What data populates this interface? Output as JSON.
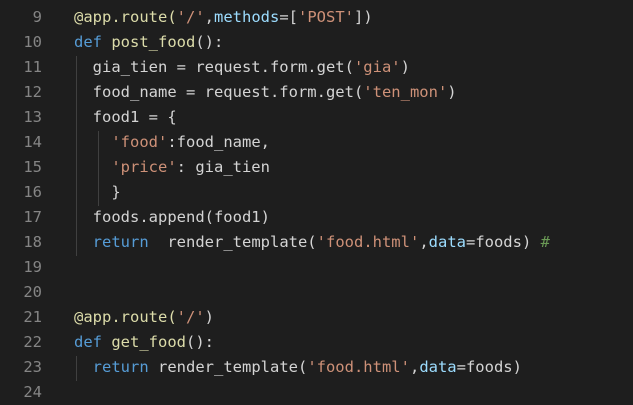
{
  "editor": {
    "lines": [
      {
        "num": "9",
        "segments": [
          {
            "t": "@app.route(",
            "c": "fn"
          },
          {
            "t": "'/'",
            "c": "str"
          },
          {
            "t": ",",
            "c": "txt"
          },
          {
            "t": "methods",
            "c": "var"
          },
          {
            "t": "=[",
            "c": "txt"
          },
          {
            "t": "'POST'",
            "c": "str"
          },
          {
            "t": "])",
            "c": "txt"
          }
        ]
      },
      {
        "num": "10",
        "segments": [
          {
            "t": "def ",
            "c": "kw"
          },
          {
            "t": "post_food",
            "c": "fn"
          },
          {
            "t": "():",
            "c": "txt"
          }
        ]
      },
      {
        "num": "11",
        "segments": [
          {
            "t": "  gia_tien = request.form.get(",
            "c": "txt"
          },
          {
            "t": "'gia'",
            "c": "str"
          },
          {
            "t": ")",
            "c": "txt"
          }
        ]
      },
      {
        "num": "12",
        "segments": [
          {
            "t": "  food_name = request.form.get(",
            "c": "txt"
          },
          {
            "t": "'ten_mon'",
            "c": "str"
          },
          {
            "t": ")",
            "c": "txt"
          }
        ]
      },
      {
        "num": "13",
        "segments": [
          {
            "t": "  food1 = {",
            "c": "txt"
          }
        ]
      },
      {
        "num": "14",
        "segments": [
          {
            "t": "    ",
            "c": "txt"
          },
          {
            "t": "'food'",
            "c": "str"
          },
          {
            "t": ":food_name,",
            "c": "txt"
          }
        ]
      },
      {
        "num": "15",
        "segments": [
          {
            "t": "    ",
            "c": "txt"
          },
          {
            "t": "'price'",
            "c": "str"
          },
          {
            "t": ": gia_tien",
            "c": "txt"
          }
        ]
      },
      {
        "num": "16",
        "segments": [
          {
            "t": "    }",
            "c": "txt"
          }
        ]
      },
      {
        "num": "17",
        "segments": [
          {
            "t": "  foods.append(food1)",
            "c": "txt"
          }
        ]
      },
      {
        "num": "18",
        "segments": [
          {
            "t": "  ",
            "c": "txt"
          },
          {
            "t": "return",
            "c": "kw"
          },
          {
            "t": "  render_template(",
            "c": "txt"
          },
          {
            "t": "'food.html'",
            "c": "str"
          },
          {
            "t": ",",
            "c": "txt"
          },
          {
            "t": "data",
            "c": "var"
          },
          {
            "t": "=foods) ",
            "c": "txt"
          },
          {
            "t": "#",
            "c": "cmt"
          }
        ]
      },
      {
        "num": "19",
        "segments": []
      },
      {
        "num": "20",
        "segments": []
      },
      {
        "num": "21",
        "segments": [
          {
            "t": "@app.route(",
            "c": "fn"
          },
          {
            "t": "'/'",
            "c": "str"
          },
          {
            "t": ")",
            "c": "txt"
          }
        ]
      },
      {
        "num": "22",
        "segments": [
          {
            "t": "def ",
            "c": "kw"
          },
          {
            "t": "get_food",
            "c": "fn"
          },
          {
            "t": "():",
            "c": "txt"
          }
        ]
      },
      {
        "num": "23",
        "segments": [
          {
            "t": "  ",
            "c": "txt"
          },
          {
            "t": "return",
            "c": "kw"
          },
          {
            "t": " render_template(",
            "c": "txt"
          },
          {
            "t": "'food.html'",
            "c": "str"
          },
          {
            "t": ",",
            "c": "txt"
          },
          {
            "t": "data",
            "c": "var"
          },
          {
            "t": "=foods)",
            "c": "txt"
          }
        ]
      },
      {
        "num": "24",
        "segments": []
      }
    ]
  },
  "colors": {
    "background": "#1e1e1e",
    "line_number": "#858585",
    "keyword": "#569cd6",
    "string": "#ce9178",
    "function": "#dcdcaa",
    "parameter": "#9cdcfe",
    "comment": "#6a9955",
    "text": "#d4d4d4"
  }
}
